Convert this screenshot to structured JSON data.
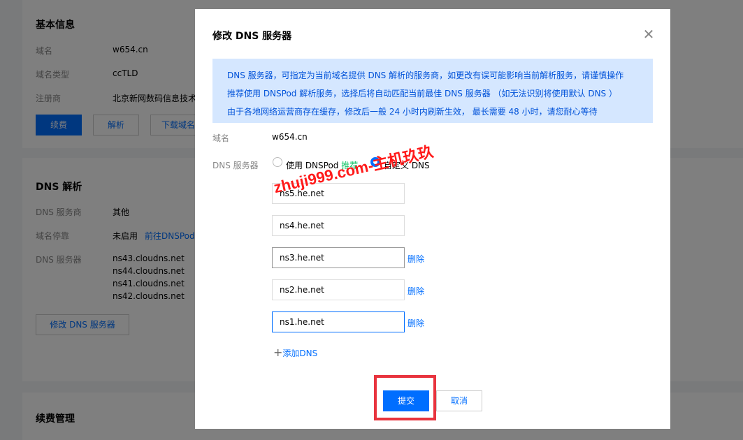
{
  "basic_info": {
    "title": "基本信息",
    "rows": [
      {
        "label": "域名",
        "value": "w654.cn"
      },
      {
        "label": "域名类型",
        "value": "ccTLD"
      },
      {
        "label": "注册商",
        "value": "北京新网数码信息技术"
      }
    ],
    "buttons": {
      "renew": "续费",
      "resolve": "解析",
      "download": "下载域名"
    }
  },
  "dns_resolve": {
    "title": "DNS 解析",
    "provider_label": "DNS 服务商",
    "provider_value": "其他",
    "parking_label": "域名停靠",
    "parking_value": "未启用",
    "parking_link": "前往DNSPod",
    "servers_label": "DNS 服务器",
    "servers": [
      "ns43.cloudns.net",
      "ns44.cloudns.net",
      "ns41.cloudns.net",
      "ns42.cloudns.net"
    ],
    "modify_button": "修改 DNS 服务器"
  },
  "renew_mgmt": {
    "title": "续费管理"
  },
  "modal": {
    "title": "修改 DNS 服务器",
    "close_icon": "close-icon",
    "notice": [
      "DNS 服务器，可指定为当前域名提供 DNS 解析的服务商，如更改有误可能影响当前解析服务，请谨慎操作",
      "推荐使用 DNSPod 解析服务，选择后将自动匹配当前最佳 DNS 服务器 （如无法识别将使用默认 DNS ）",
      "由于各地网络运营商存在缓存，修改后一般 24 小时内刷新生效， 最长需要 48 小时，请您耐心等待"
    ],
    "domain_label": "域名",
    "domain_value": "w654.cn",
    "dns_label": "DNS 服务器",
    "option_dnspod": "使用 DNSPod",
    "option_recommend": "推荐",
    "option_custom": "自定义 DNS",
    "selected_option": "自定义 DNS",
    "servers": [
      "ns5.he.net",
      "ns4.he.net",
      "ns3.he.net",
      "ns2.he.net",
      "ns1.he.net"
    ],
    "delete_label": "删除",
    "add_label": "添加DNS",
    "submit_label": "提交",
    "cancel_label": "取消"
  },
  "watermark": "zhuji999.com-主机玖玖",
  "colors": {
    "accent": "#006eff",
    "notice_bg": "#d5e7ff",
    "recommend": "#07c160",
    "highlight": "#e8343e"
  }
}
